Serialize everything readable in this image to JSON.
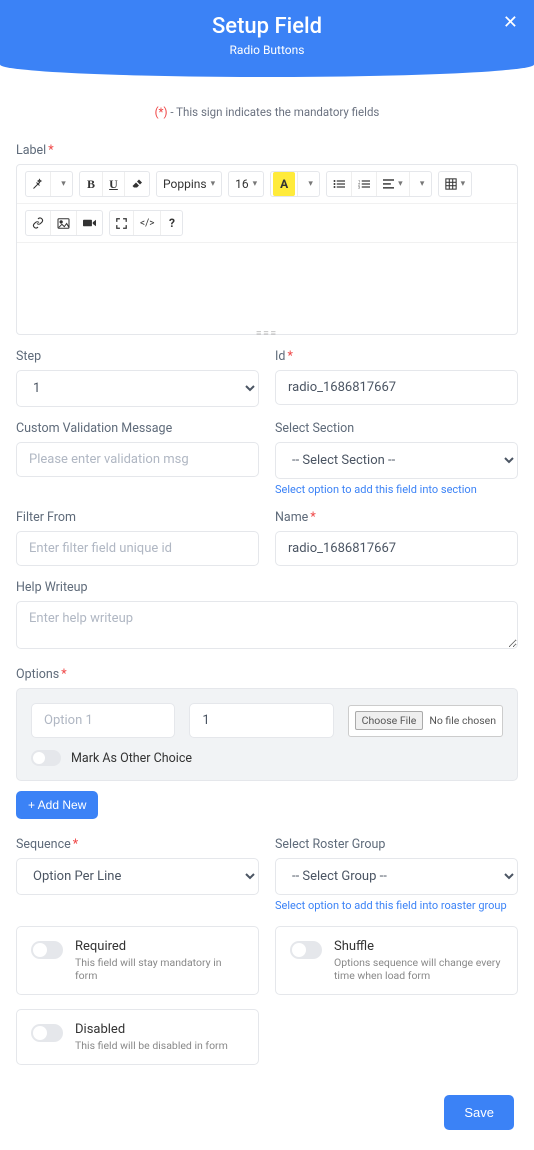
{
  "header": {
    "title": "Setup Field",
    "subtitle": "Radio Buttons"
  },
  "mandatory": {
    "star": "(*)",
    "text": " - This sign indicates the mandatory fields"
  },
  "labels": {
    "label": "Label",
    "step": "Step",
    "id": "Id",
    "validation": "Custom Validation Message",
    "select_section": "Select Section",
    "section_note": "Select option to add this field into section",
    "filter_from": "Filter From",
    "name": "Name",
    "help": "Help Writeup",
    "options": "Options",
    "sequence": "Sequence",
    "roster": "Select Roster Group",
    "roster_note": "Select option to add this field into roaster group",
    "required": "Required",
    "required_desc": "This field will stay mandatory in form",
    "shuffle": "Shuffle",
    "shuffle_desc": "Options sequence will change every time when load form",
    "disabled": "Disabled",
    "disabled_desc": "This field will be disabled in form"
  },
  "toolbar": {
    "font_family": "Poppins",
    "font_size": "16",
    "highlight_letter": "A"
  },
  "values": {
    "step": "1",
    "id": "radio_1686817667",
    "name": "radio_1686817667",
    "option_num": "1",
    "section": "-- Select Section --",
    "sequence": "Option Per Line",
    "roster_group": "-- Select Group --"
  },
  "placeholders": {
    "validation": "Please enter validation msg",
    "filter": "Enter filter field unique id",
    "help": "Enter help writeup",
    "option": "Option 1"
  },
  "buttons": {
    "add_new": "+ Add New",
    "save": "Save",
    "choose_file": "Choose File",
    "no_file": "No file chosen",
    "mark_other": "Mark As Other Choice"
  },
  "icons": {
    "close": "✕",
    "magic": "✨",
    "eraser": "◧",
    "list_ul": "≣",
    "list_ol": "≡",
    "align": "≡",
    "table": "▦",
    "link": "🔗",
    "image": "🖼",
    "video": "▬",
    "fullscreen": "⤢",
    "code": "</>",
    "help": "?"
  }
}
